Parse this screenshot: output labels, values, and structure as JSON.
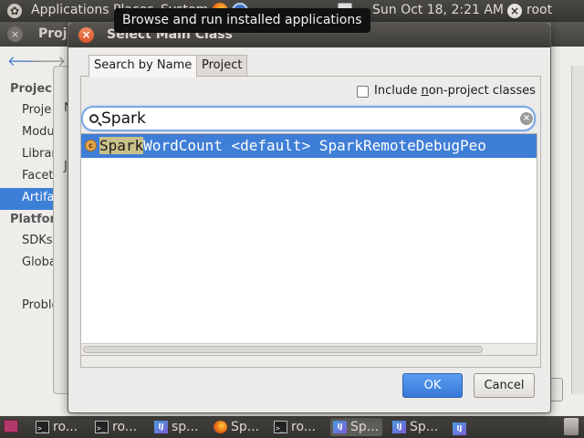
{
  "top_panel": {
    "applications": "Applications",
    "places": "Places",
    "system": "System",
    "clock": "Sun Oct 18,  2:21 AM",
    "user": "root"
  },
  "tooltip": "Browse and run installed applications",
  "bg_window": {
    "title": "Proj",
    "sidebar_heading_project": "Projec",
    "sidebar_items": [
      "Proje",
      "Modu",
      "Librar",
      "Facet",
      "Artifa"
    ],
    "sidebar_heading_platform": "Platfor",
    "platform_items": [
      "SDKs",
      "Globa"
    ],
    "problems": "Proble",
    "letters": [
      "N",
      "J"
    ]
  },
  "dialog": {
    "title": "Select Main Class",
    "tabs": [
      "Search by Name",
      "Project"
    ],
    "include_label_pre": "Include ",
    "include_label_u": "n",
    "include_label_post": "on-project classes",
    "search_value": "Spark",
    "results": [
      {
        "icon_letter": "c",
        "match": "Spark",
        "rest": "WordCount <default> SparkRemoteDebugPeo"
      }
    ],
    "ok_label": "OK",
    "cancel_label": "Cancel"
  },
  "taskbar": {
    "items": [
      {
        "label": "ro...",
        "icon": "terminal-icon"
      },
      {
        "label": "ro...",
        "icon": "terminal-icon"
      },
      {
        "label": "sp...",
        "icon": "intellij-icon"
      },
      {
        "label": "Sp...",
        "icon": "firefox-icon"
      },
      {
        "label": "ro...",
        "icon": "terminal-icon"
      },
      {
        "label": "Sp...",
        "icon": "intellij-icon"
      },
      {
        "label": "Sp...",
        "icon": "intellij-icon"
      }
    ]
  }
}
